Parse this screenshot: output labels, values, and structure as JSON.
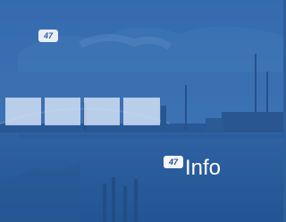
{
  "logos": {
    "corner_text": "47",
    "info_text": "47"
  },
  "info": {
    "label": "Info"
  },
  "colors": {
    "sky": "#3a6fb0",
    "water": "#2e5a96",
    "card": "#dce8f8",
    "text": "#ffffff"
  }
}
